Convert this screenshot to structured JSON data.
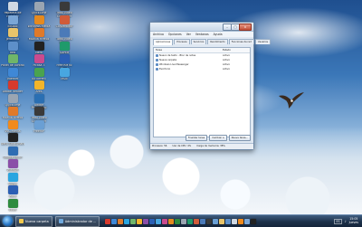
{
  "desktop": {
    "icons": [
      {
        "label": "Papelera de reciclaje",
        "color": "#cfd8e3"
      },
      {
        "label": "Equipo",
        "color": "#7aa6d6"
      },
      {
        "label": "Jeronimo",
        "color": "#e9c46a"
      },
      {
        "label": "Red",
        "color": "#5d8fc9"
      },
      {
        "label": "Panel de control",
        "color": "#6fb56a"
      },
      {
        "label": "Internet",
        "color": "#3f88d6"
      },
      {
        "label": "Adobe Reader",
        "color": "#d63a2e"
      },
      {
        "label": "QuickTime Player",
        "color": "#9aa5b2"
      },
      {
        "label": "Mozilla Firefox",
        "color": "#e07a2a"
      },
      {
        "label": "VLC media player",
        "color": "#f08a1c"
      },
      {
        "label": "Nero StartSmart",
        "color": "#222222"
      },
      {
        "label": "Google Earth",
        "color": "#2f6db3"
      },
      {
        "label": "WinRAR",
        "color": "#8b4fa8"
      },
      {
        "label": "Skype",
        "color": "#2aa5e0"
      },
      {
        "label": "Word",
        "color": "#2b5fb4"
      },
      {
        "label": "Excel",
        "color": "#2e8b3e"
      }
    ],
    "icons_col2": [
      {
        "label": "QuickTime Player",
        "color": "#9aa5b2"
      },
      {
        "label": "Windows Media Player",
        "color": "#e58a1f"
      },
      {
        "label": "Mozilla Firefox",
        "color": "#e07a2a"
      },
      {
        "label": "Nero",
        "color": "#222222"
      },
      {
        "label": "Picasa 3",
        "color": "#c94b8f"
      },
      {
        "label": "BitTorrent",
        "color": "#4aa34f"
      },
      {
        "label": "Ares",
        "color": "#f2b52b"
      },
      {
        "label": "Adobe Photoshop",
        "color": "#2a6fb3"
      },
      {
        "label": "Total Video Converter",
        "color": "#3a3a3a"
      },
      {
        "label": "FreeRIP",
        "color": "#6a9fd4"
      }
    ],
    "icons_col3": [
      {
        "label": "Total Video Converter",
        "color": "#3a3a3a"
      },
      {
        "label": "Convertidor",
        "color": "#d05b3a"
      },
      {
        "label": "Total Video Player",
        "color": "#4b7ab8"
      },
      {
        "label": "SUPER",
        "color": "#1f9a6b"
      },
      {
        "label": "Free RM to Word",
        "color": "#2b5fb4"
      },
      {
        "label": "MSN",
        "color": "#48a6e0"
      }
    ]
  },
  "window": {
    "title": "Administrador de tareas de Windows",
    "menu": [
      "Archivo",
      "Opciones",
      "Ver",
      "Ventanas",
      "Ayuda"
    ],
    "tabs": [
      "Aplicaciones",
      "Procesos",
      "Servicios",
      "Rendimiento",
      "Funciones de red",
      "Usuarios"
    ],
    "columns": {
      "task": "Tarea",
      "status": "Estado"
    },
    "rows": [
      {
        "task": "Nuevo de texto - Bloc de notas",
        "status": "Activo"
      },
      {
        "task": "Nueva carpeta",
        "status": "Activo"
      },
      {
        "task": "Windows Live Messenger",
        "status": "Activo"
      },
      {
        "task": "Escritorio",
        "status": "Activo"
      }
    ],
    "buttons": {
      "end_task": "Finalizar tarea",
      "switch_to": "Cambiar a",
      "new_task": "Nueva tarea..."
    },
    "status": {
      "processes": "Procesos: 56",
      "cpu": "Uso de CPU: 4%",
      "memory": "Carga de memoria: 38%"
    }
  },
  "taskbar": {
    "buttons": [
      {
        "label": "Nueva carpeta",
        "color": "#f2c94c"
      },
      {
        "label": "Administrador de ...",
        "color": "#6fa8dc"
      }
    ],
    "quick_launch_colors": [
      "#d63a2e",
      "#3f88d6",
      "#e07a2a",
      "#2aa5e0",
      "#6fb56a",
      "#f2b52b",
      "#8b4fa8",
      "#2b5fb4",
      "#48a6e0",
      "#c94b8f",
      "#e58a1f",
      "#2e8b3e",
      "#9aa5b2",
      "#1f9a6b",
      "#d05b3a",
      "#4b7ab8",
      "#3a3a3a",
      "#6a9fd4",
      "#e9c46a",
      "#5d8fc9",
      "#cfd8e3",
      "#f08a1c",
      "#7aa6d6",
      "#222222"
    ],
    "language": "ES",
    "time": "15:05",
    "day": "Jueves"
  }
}
